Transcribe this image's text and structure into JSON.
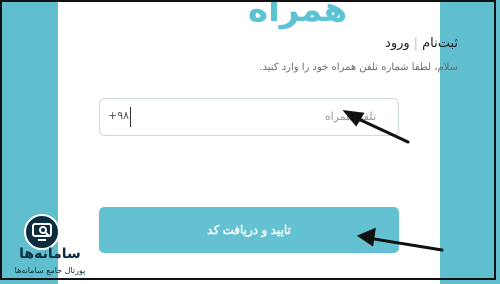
{
  "header": {
    "logo_text": "همراه",
    "tab_register": "ثبت‌نام",
    "separator": "|",
    "tab_login": "ورود"
  },
  "form": {
    "instruction": "سلام، لطفا شماره تلفن همراه خود را وارد کنید.",
    "phone_prefix": "+۹۸",
    "phone_placeholder": "تلفن همراه",
    "submit_label": "تایید و دریافت کد"
  },
  "watermark": {
    "title": "سامانه‌ها",
    "subtitle": "پورتال جامع سامانه‌ها"
  },
  "colors": {
    "background": "#60bfcf",
    "button": "#63c1d2",
    "badge": "#0d2c3f"
  }
}
